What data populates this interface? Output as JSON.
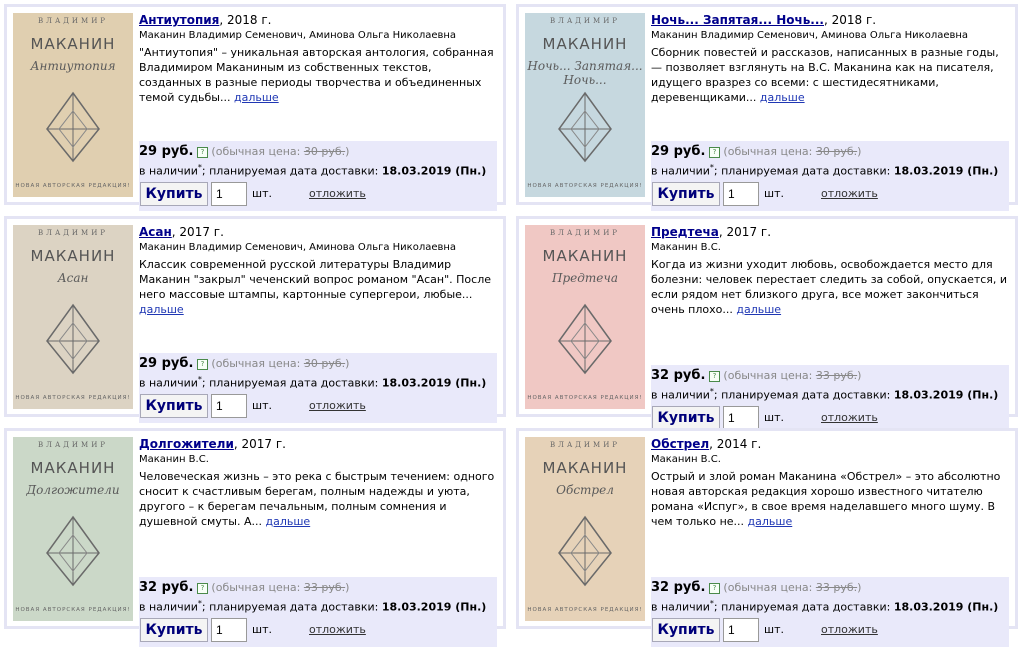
{
  "labels": {
    "price_note_prefix": "(обычная цена:",
    "price_note_suffix": ")",
    "availability": "в наличии",
    "availability_star": "*",
    "delivery_text": "; планируемая дата доставки:",
    "buy": "Купить",
    "pcs": "шт.",
    "defer": "отложить",
    "more": "дальше",
    "help_glyph": "?"
  },
  "cover": {
    "author_caption": "ВЛАДИМИР",
    "surname": "МАКАНИН",
    "edition": "НОВАЯ АВТОРСКАЯ РЕДАКЦИЯ!"
  },
  "books": [
    {
      "title": "Антиутопия",
      "year": ", 2018 г.",
      "authors": "Маканин Владимир Семенович, Аминова Ольга Николаевна",
      "annotation": "\"Антиутопия\" – уникальная авторская антология, собранная Владимиром Маканиным из собственных текстов, созданных в разные периоды творчества и объединенных темой судьбы...",
      "price": "29 руб.",
      "old_price": "30 руб.",
      "date": "18.03.2019 (Пн.)",
      "qty": "1",
      "cover_script": "Антиутопия",
      "cover_color": "#e0cfb0"
    },
    {
      "title": "Ночь... Запятая... Ночь...",
      "year": ", 2018 г.",
      "authors": "Маканин Владимир Семенович, Аминова Ольга Николаевна",
      "annotation": "Сборник повестей и рассказов, написанных в разные годы, — позволяет взглянуть на В.С. Маканина как на писателя, идущего вразрез со всеми: с шестидесятниками, деревенщиками...",
      "price": "29 руб.",
      "old_price": "30 руб.",
      "date": "18.03.2019 (Пн.)",
      "qty": "1",
      "cover_script": "Ночь... Запятая... Ночь...",
      "cover_color": "#c6d8df"
    },
    {
      "title": "Асан",
      "year": ", 2017 г.",
      "authors": "Маканин Владимир Семенович, Аминова Ольга Николаевна",
      "annotation": "Классик современной русской литературы Владимир Маканин \"закрыл\" чеченский вопрос романом \"Асан\". После него массовые штампы, картонные супергерои, любые...",
      "price": "29 руб.",
      "old_price": "30 руб.",
      "date": "18.03.2019 (Пн.)",
      "qty": "1",
      "cover_script": "Асан",
      "cover_color": "#dcd3c3"
    },
    {
      "title": "Предтеча",
      "year": ", 2017 г.",
      "authors": "Маканин В.С.",
      "annotation": "Когда из жизни уходит любовь, освобождается место для болезни: человек перестает следить за собой, опускается, и если рядом нет близкого друга, все может закончиться очень плохо...",
      "price": "32 руб.",
      "old_price": "33 руб.",
      "date": "18.03.2019 (Пн.)",
      "qty": "1",
      "cover_script": "Предтеча",
      "cover_color": "#f0c8c4"
    },
    {
      "title": "Долгожители",
      "year": ", 2017 г.",
      "authors": "Маканин В.С.",
      "annotation": "Человеческая жизнь – это река с быстрым течением: одного сносит к счастливым берегам, полным надежды и уюта, другого – к берегам печальным, полным сомнения и душевной смуты. А...",
      "price": "32 руб.",
      "old_price": "33 руб.",
      "date": "18.03.2019 (Пн.)",
      "qty": "1",
      "cover_script": "Долгожители",
      "cover_color": "#cbd8c8"
    },
    {
      "title": "Обстрел",
      "year": ", 2014 г.",
      "authors": "Маканин В.С.",
      "annotation": "Острый и злой роман Маканина «Обстрел» – это абсолютно новая авторская редакция хорошо известного читателю романа «Испуг», в свое время наделавшего много шуму. В чем только не...",
      "price": "32 руб.",
      "old_price": "33 руб.",
      "date": "18.03.2019 (Пн.)",
      "qty": "1",
      "cover_script": "Обстрел",
      "cover_color": "#e6d2b8"
    }
  ]
}
